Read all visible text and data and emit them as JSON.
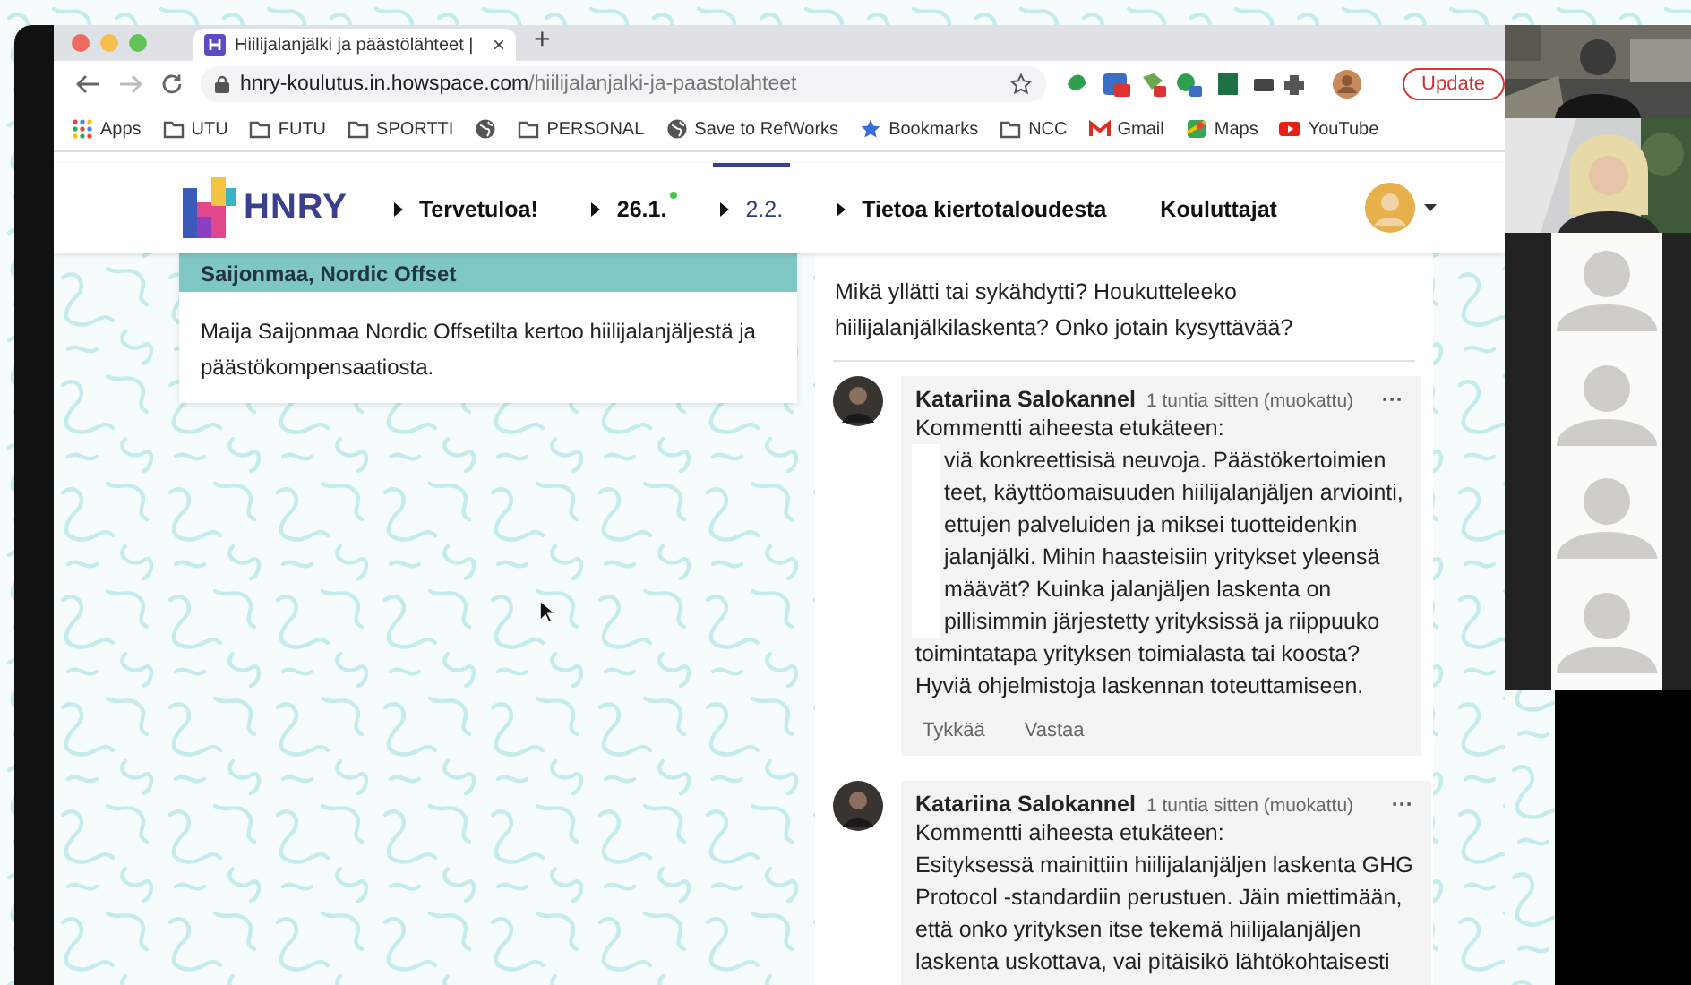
{
  "browser": {
    "tab_title": "Hiilijalanjälki ja päästölähteet |",
    "tab_close": "×",
    "new_tab": "+",
    "url_host": "hnry-koulutus.in.howspace.com",
    "url_path": "/hiilijalanjalki-ja-paastolahteet",
    "update_button": "Update"
  },
  "bookmarks": [
    {
      "label": "Apps",
      "kind": "apps"
    },
    {
      "label": "UTU",
      "kind": "folder"
    },
    {
      "label": "FUTU",
      "kind": "folder"
    },
    {
      "label": "SPORTTI",
      "kind": "folder"
    },
    {
      "kind": "globe"
    },
    {
      "label": "PERSONAL",
      "kind": "folder"
    },
    {
      "label": "Save to RefWorks",
      "kind": "globe"
    },
    {
      "label": "Bookmarks",
      "kind": "star"
    },
    {
      "label": "NCC",
      "kind": "folder"
    },
    {
      "label": "Gmail",
      "kind": "gmail"
    },
    {
      "label": "Maps",
      "kind": "maps"
    },
    {
      "label": "YouTube",
      "kind": "youtube"
    }
  ],
  "site_nav": {
    "logo": "HNRY",
    "items": [
      {
        "label": "Tervetuloa!",
        "selected": false,
        "has_children": true,
        "new": false
      },
      {
        "label": "26.1.",
        "selected": false,
        "has_children": true,
        "new": true
      },
      {
        "label": "2.2.",
        "selected": true,
        "has_children": true,
        "new": false
      },
      {
        "label": "Tietoa kiertotaloudesta",
        "selected": false,
        "has_children": true,
        "new": false
      },
      {
        "label": "Kouluttajat",
        "selected": false,
        "has_children": false,
        "new": false
      }
    ]
  },
  "left_card": {
    "title": "Saijonmaa, Nordic Offset",
    "text": "Maija Saijonmaa Nordic Offsetilta kertoo hiilijalanjäljestä ja päästökompensaatiosta."
  },
  "right_card": {
    "question": "Mikä yllätti tai sykähdytti? Houkutteleeko hiilijalanjälkilaskenta? Onko jotain kysyttävää?",
    "comments": [
      {
        "author": "Katariina Salokannel",
        "time": "1 tuntia sitten (muokattu)",
        "menu": "···",
        "lines": [
          {
            "text": "Kommentti aiheesta etukäteen:",
            "covered": false
          },
          {
            "text": "viä konkreettisisä neuvoja. Päästökertoimien",
            "covered": true
          },
          {
            "text": "teet, käyttöomaisuuden hiilijalanjäljen arviointi,",
            "covered": true
          },
          {
            "text": "ettujen palveluiden ja miksei tuotteidenkin",
            "covered": true
          },
          {
            "text": "jalanjälki. Mihin haasteisiin yritykset yleensä",
            "covered": true
          },
          {
            "text": "määvät? Kuinka jalanjäljen laskenta on",
            "covered": true
          },
          {
            "text": "pillisimmin järjestetty yrityksissä ja riippuuko",
            "covered": true
          },
          {
            "text": "toimintatapa yrityksen toimialasta tai koosta?",
            "covered": false
          },
          {
            "text": "Hyviä ohjelmistoja laskennan toteuttamiseen.",
            "covered": false
          }
        ],
        "actions": [
          "Tykkää",
          "Vastaa"
        ]
      },
      {
        "author": "Katariina Salokannel",
        "time": "1 tuntia sitten (muokattu)",
        "menu": "···",
        "lines": [
          {
            "text": "Kommentti aiheesta etukäteen:",
            "covered": false
          },
          {
            "text": "Esityksessä mainittiin hiilijalanjäljen laskenta GHG",
            "covered": false
          },
          {
            "text": "Protocol -standardiin perustuen. Jäin miettimään,",
            "covered": false
          },
          {
            "text": "että onko yrityksen itse tekemä hiilijalanjäljen",
            "covered": false
          },
          {
            "text": "laskenta uskottava, vai pitäisikö lähtökohtaisesti",
            "covered": false
          }
        ]
      }
    ]
  },
  "participants": [
    {
      "kind": "video"
    },
    {
      "kind": "video"
    },
    {
      "kind": "avatar"
    },
    {
      "kind": "avatar"
    },
    {
      "kind": "avatar"
    },
    {
      "kind": "avatar"
    }
  ]
}
